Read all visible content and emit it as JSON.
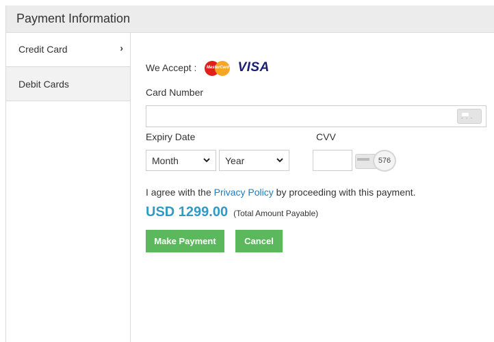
{
  "panel": {
    "title": "Payment Information"
  },
  "sidebar": {
    "items": [
      {
        "label": "Credit Card",
        "active": true,
        "chevron": "›"
      },
      {
        "label": "Debit Cards",
        "active": false
      }
    ]
  },
  "form": {
    "we_accept_label": "We Accept :",
    "accepted_cards": [
      "mastercard-logo",
      "visa-logo"
    ],
    "mastercard_text": "MasterCard",
    "visa_text": "VISA",
    "card_number_label": "Card Number",
    "card_number_value": "",
    "expiry_label": "Expiry Date",
    "month_select": {
      "selected": "Month"
    },
    "year_select": {
      "selected": "Year"
    },
    "cvv_label": "CVV",
    "cvv_value": "",
    "cvv_hint": "576",
    "agree_prefix": "I agree with the ",
    "privacy_link": "Privacy Policy",
    "agree_suffix": " by proceeding with this payment.",
    "amount": "USD 1299.00",
    "amount_note": "(Total Amount Payable)",
    "make_payment_label": "Make Payment",
    "cancel_label": "Cancel"
  },
  "colors": {
    "accent_green": "#5cb85c",
    "amount_blue": "#2e9ac6",
    "link_blue": "#1f7bbf",
    "visa_navy": "#1a1f71",
    "mastercard_red": "#e0201b",
    "mastercard_orange": "#f5a623"
  }
}
